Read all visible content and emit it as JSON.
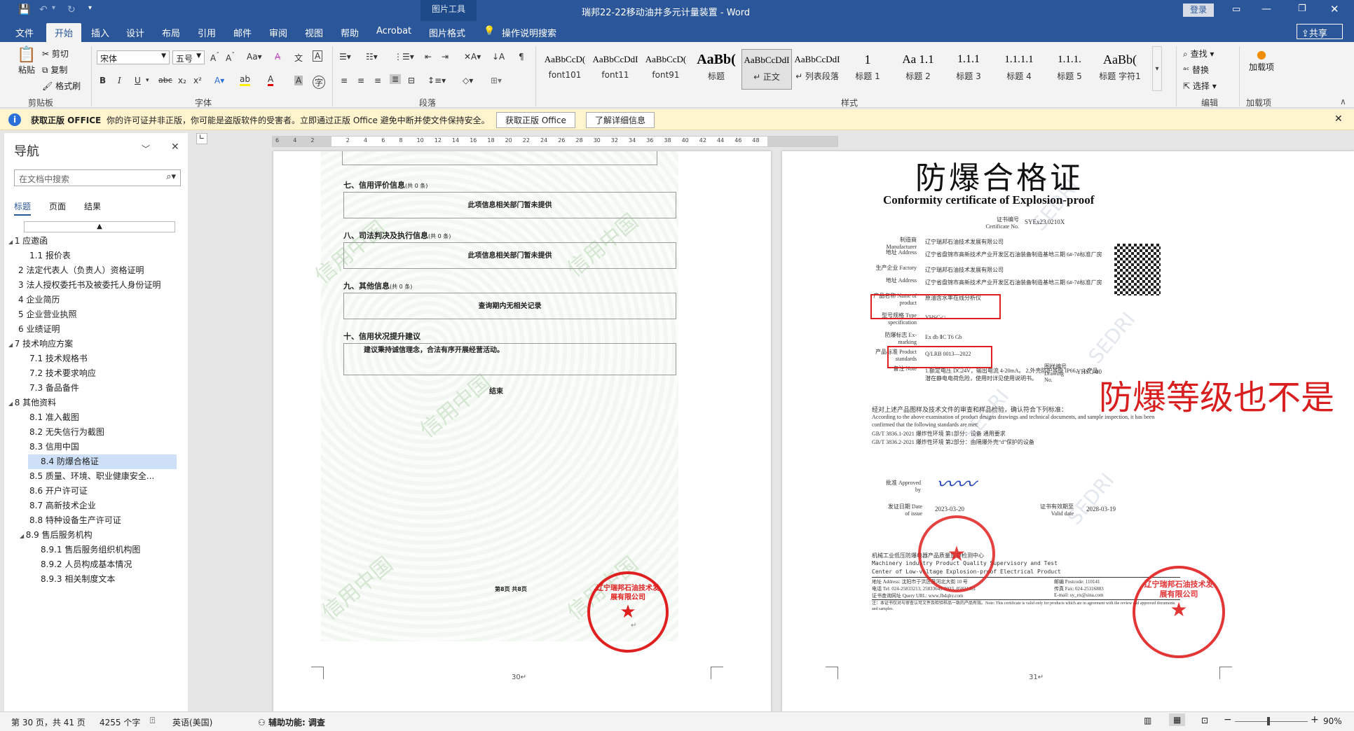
{
  "titlebar": {
    "context_tab": "图片工具",
    "title": "瑞邦22-22移动油井多元计量装置 - Word",
    "login": "登录"
  },
  "tabs": [
    "文件",
    "开始",
    "插入",
    "设计",
    "布局",
    "引用",
    "邮件",
    "审阅",
    "视图",
    "帮助",
    "Acrobat",
    "图片格式"
  ],
  "tell_me": "操作说明搜索",
  "share": "共享",
  "ribbon": {
    "clipboard": {
      "paste": "粘贴",
      "cut": "剪切",
      "copy": "复制",
      "painter": "格式刷",
      "label": "剪贴板"
    },
    "font": {
      "name": "宋体",
      "size": "五号",
      "label": "字体"
    },
    "paragraph": {
      "label": "段落"
    },
    "styles": {
      "label": "样式",
      "items": [
        {
          "prev": "AaBbCcD(",
          "name": "font101"
        },
        {
          "prev": "AaBbCcDdI",
          "name": "font11"
        },
        {
          "prev": "AaBbCcD(",
          "name": "font91"
        },
        {
          "prev": "AaBb(",
          "name": "标题"
        },
        {
          "prev": "AaBbCcDdI",
          "name": "↵ 正文"
        },
        {
          "prev": "AaBbCcDdI",
          "name": "↵ 列表段落"
        },
        {
          "prev": "1",
          "name": "标题 1"
        },
        {
          "prev": "Aa 1.1",
          "name": "标题 2"
        },
        {
          "prev": "1.1.1",
          "name": "标题 3"
        },
        {
          "prev": "1.1.1.1",
          "name": "标题 4"
        },
        {
          "prev": "1.1.1.",
          "name": "标题 5"
        },
        {
          "prev": "AaBb(",
          "name": "标题 字符1"
        }
      ]
    },
    "editing": {
      "find": "查找",
      "replace": "替换",
      "select": "选择",
      "label": "编辑"
    },
    "addins": {
      "load": "加载项",
      "label": "加载项"
    }
  },
  "notice": {
    "title": "获取正版 OFFICE",
    "text": "你的许可证并非正版，你可能是盗版软件的受害者。立即通过正版 Office 避免中断并使文件保持安全。",
    "btn1": "获取正版 Office",
    "btn2": "了解详细信息"
  },
  "nav": {
    "title": "导航",
    "search_placeholder": "在文档中搜索",
    "tabs": [
      "标题",
      "页面",
      "结果"
    ],
    "items": [
      {
        "text": "1 应邀函",
        "level": 0,
        "caret": true
      },
      {
        "text": "1.1 报价表",
        "level": 1
      },
      {
        "text": "2 法定代表人（负责人）资格证明",
        "level": 0
      },
      {
        "text": "3 法人授权委托书及被委托人身份证明",
        "level": 0
      },
      {
        "text": "4 企业简历",
        "level": 0
      },
      {
        "text": "5 企业营业执照",
        "level": 0
      },
      {
        "text": "6 业绩证明",
        "level": 0
      },
      {
        "text": "7 技术响应方案",
        "level": 0,
        "caret": true
      },
      {
        "text": "7.1 技术规格书",
        "level": 1
      },
      {
        "text": "7.2 技术要求响应",
        "level": 1
      },
      {
        "text": "7.3 备品备件",
        "level": 1
      },
      {
        "text": "8 其他资料",
        "level": 0,
        "caret": true
      },
      {
        "text": "8.1 准入截图",
        "level": 1
      },
      {
        "text": "8.2 无失信行为截图",
        "level": 1
      },
      {
        "text": "8.3 信用中国",
        "level": 1
      },
      {
        "text": "8.4 防爆合格证",
        "level": 1,
        "selected": true
      },
      {
        "text": "8.5 质量、环境、职业健康安全...",
        "level": 1
      },
      {
        "text": "8.6 开户许可证",
        "level": 1
      },
      {
        "text": "8.7 高新技术企业",
        "level": 1
      },
      {
        "text": "8.8 特种设备生产许可证",
        "level": 1
      },
      {
        "text": "8.9 售后服务机构",
        "level": 1,
        "caret": true
      },
      {
        "text": "8.9.1 售后服务组织机构图",
        "level": 2
      },
      {
        "text": "8.9.2 人员构成基本情况",
        "level": 2
      },
      {
        "text": "8.9.3 相关制度文本",
        "level": 2
      }
    ]
  },
  "ruler": [
    "6",
    "4",
    "2",
    "",
    "2",
    "4",
    "6",
    "8",
    "10",
    "12",
    "14",
    "16",
    "18",
    "20",
    "22",
    "24",
    "26",
    "28",
    "30",
    "32",
    "34",
    "36",
    "38",
    "40",
    "42",
    "44",
    "46",
    "48"
  ],
  "page30": {
    "sections": [
      {
        "title": "七、信用评价信息",
        "count": "(共 0 条)",
        "box": "此项信息相关部门暂未提供"
      },
      {
        "title": "八、司法判决及执行信息",
        "count": "(共 0 条)",
        "box": "此项信息相关部门暂未提供"
      },
      {
        "title": "九、其他信息",
        "count": "(共 0 条)",
        "box": "查询期内无相关记录"
      },
      {
        "title": "十、信用状况提升建议",
        "count": "",
        "box": "建议秉持诚信理念，合法有序开展经营活动。"
      }
    ],
    "end": "结束",
    "footer": "第8页 共8页",
    "page_no": "30↵",
    "watermark": "信用中国",
    "stamp": "辽宁瑞邦石油技术发展有限公司"
  },
  "page31": {
    "title_cn": "防爆合格证",
    "title_en": "Conformity certificate of Explosion-proof",
    "cert_no_label": "证书编号 Certificate No.",
    "cert_no": "SYEx23.0210X",
    "rows": [
      {
        "label": "制造商 Manufacturer",
        "value": "辽宁瑞邦石油技术发展有限公司"
      },
      {
        "label": "地址 Address",
        "value": "辽宁省盘锦市高新技术产业开发区石油装备制造基地三期 6#-7#标准厂房"
      },
      {
        "label": "生产企业 Factory",
        "value": "辽宁瑞邦石油技术发展有限公司"
      },
      {
        "label": "地址 Address",
        "value": "辽宁省盘锦市高新技术产业开发区石油装备制造基地三期 6#-7#标准厂房"
      },
      {
        "label": "产品名称 Name of product",
        "value": "原油含水率在线分析仪"
      },
      {
        "label": "型号规格 Type specification",
        "value": "YHSC-□"
      },
      {
        "label": "防爆标志 Ex-marking",
        "value": "Ex db ⅡC T6 Gb"
      },
      {
        "label": "产品标准 Product standards",
        "value": "Q/LRB 0013—2022"
      },
      {
        "label": "备注 Note",
        "value": "1.额定电压 DC24V，输出电流 4-20mA。 2.外壳防护等级 IP66。 3.产品潜在静电电荷危险，使用时详见使用说明书。"
      }
    ],
    "drawing_label": "图样编号 Drawing No.",
    "drawing_no": "YHSC-00",
    "verify_cn": "经对上述产品图样及技术文件的审查和样品检验，确认符合下列标准：",
    "verify_en": "According to the above examination of product designs drawings and technical documents, and sample inspection, it has been confirmed that the following standards are met:",
    "std1": "GB/T 3836.1-2021  爆炸性环境 第1部分：设备 通用要求",
    "std2": "GB/T 3836.2-2021  爆炸性环境 第2部分：由隔爆外壳“d”保护的设备",
    "approved": "批准 Approved by",
    "issue_label": "发证日期 Date of issue",
    "issue_date": "2023-03-20",
    "valid_label": "证书有效期至 Valid date",
    "valid_date": "2028-03-19",
    "org_cn": "机械工业低压防爆电器产品质量监督检测中心",
    "org_en1": "Machinery industry Product Quality Supervisory and Test",
    "org_en2": "Center of Low-voltage Explosion-proof Electrical Product",
    "addr": "地址 Address: 沈阳市于洪区黄河北大街 10 号",
    "postcode": "邮编 Postcode: 110141",
    "tel": "电话 Tel: 024-25833213, 25833649-8033, 85831461",
    "fax": "传真 Fax: 024-25316883",
    "url": "证书查询网址 Query URL: www.fbdqhy.com",
    "email": "E-mail: sy_ex@sina.com",
    "note": "注：本证书仅对与审查认可文件及检验样品一致的产品有效。Note: This certificate is valid only for products which are in agreement with the review and approved documents and samples.",
    "page_no": "31↵",
    "annotation": "防爆等级也不是",
    "stamp": "辽宁瑞邦石油技术发展有限公司",
    "watermark": "SEDRI"
  },
  "status": {
    "page": "第 30 页，共 41 页",
    "words": "4255 个字",
    "lang": "英语(美国)",
    "access": "辅助功能: 调查",
    "zoom": "90%"
  }
}
